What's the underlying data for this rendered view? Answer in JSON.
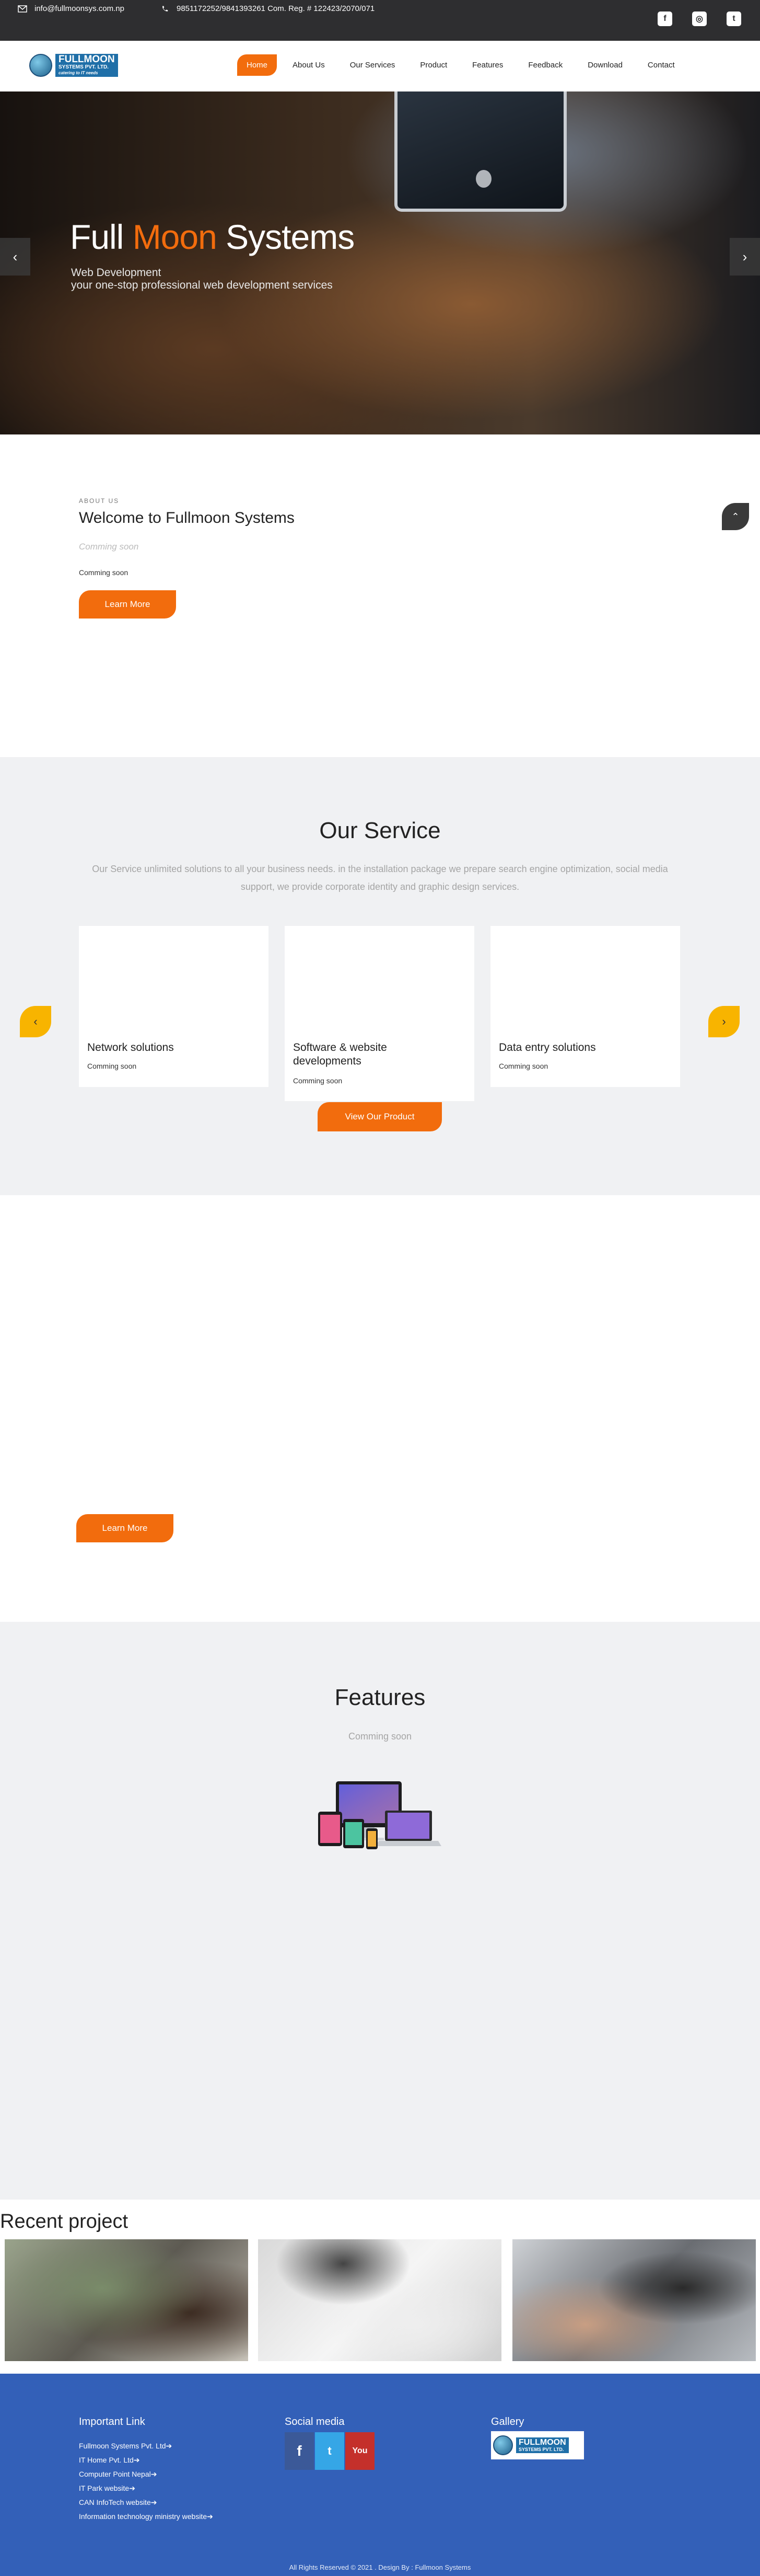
{
  "topbar": {
    "email": "info@fullmoonsys.com.np",
    "phone": "9851172252/9841393261 Com. Reg. # 122423/2070/071",
    "social": [
      "facebook-icon",
      "instagram-icon",
      "twitter-icon"
    ]
  },
  "nav": {
    "logo_line1": "FULLMOON",
    "logo_line2": "SYSTEMS PVT. LTD.",
    "logo_tagline": "catering to IT needs",
    "items": [
      "Home",
      "About Us",
      "Our Services",
      "Product",
      "Features",
      "Feedback",
      "Download",
      "Contact"
    ],
    "active": "Home"
  },
  "hero": {
    "title_part1": "Full",
    "title_part2": "Moon",
    "title_part3": "Systems",
    "subtitle_line1": "Web Development",
    "subtitle_line2": "your one-stop professional web development services",
    "prev": "‹",
    "next": "›"
  },
  "about": {
    "kicker": "ABOUT US",
    "title": "Welcome to Fullmoon Systems",
    "italic": "Comming soon",
    "text": "Comming soon",
    "button": "Learn More",
    "scroll_icon": "⌃"
  },
  "services": {
    "title": "Our Service",
    "description": "Our Service unlimited solutions to all your business needs. in the installation package we prepare search engine optimization, social media support, we provide corporate identity and graphic design services.",
    "cards": [
      {
        "title": "Network solutions",
        "text": "Comming soon"
      },
      {
        "title": "Software & website developments",
        "text": "Comming soon"
      },
      {
        "title": "Data entry solutions",
        "text": "Comming soon"
      }
    ],
    "button": "View Our Product",
    "prev": "‹",
    "next": "›"
  },
  "blank": {
    "button": "Learn More"
  },
  "features": {
    "title": "Features",
    "subtitle": "Comming soon"
  },
  "recent": {
    "title": "Recent project"
  },
  "footer": {
    "links_title": "Important Link",
    "links": [
      "Fullmoon Systems Pvt. Ltd",
      "IT Home Pvt. Ltd",
      "Computer Point Nepal",
      "IT Park website",
      "CAN InfoTech website",
      "Information technology ministry website"
    ],
    "link_arrow": "➔",
    "social_title": "Social media",
    "social_labels": [
      "f",
      "t",
      "You"
    ],
    "gallery_title": "Gallery",
    "copyright": "All Rights Reserved © 2021 . Design By : Fullmoon Systems"
  },
  "colors": {
    "accent": "#f26c0d",
    "topbar": "#2e2e30",
    "footer": "#3360b8",
    "section_grey": "#f0f1f3",
    "yellow": "#f8b400",
    "facebook": "#3b5998",
    "twitter": "#35a6e6",
    "youtube": "#c4302b"
  }
}
